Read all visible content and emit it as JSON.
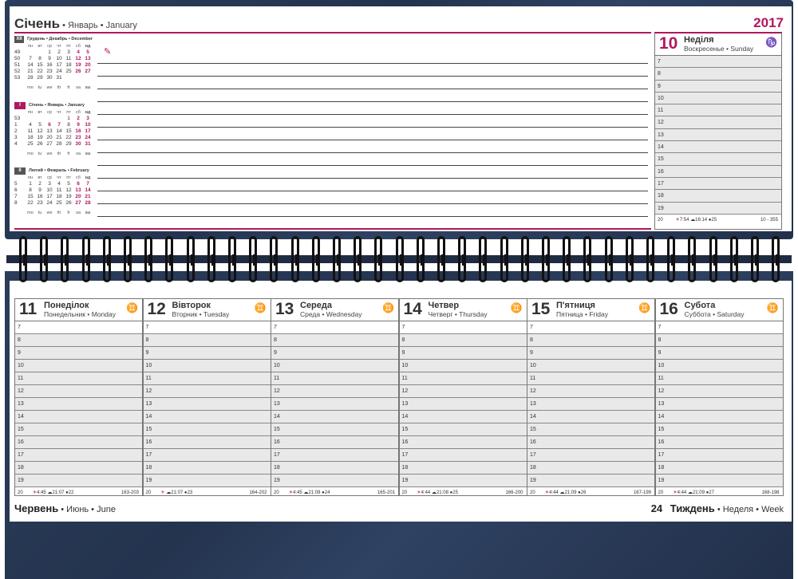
{
  "header": {
    "month_ua": "Січень",
    "month_sub": " • Январь • January",
    "year": "2017"
  },
  "mini_calendars": [
    {
      "num": "XII",
      "num_color": "#555555",
      "name": "Грудень • Декабрь • December",
      "dow": [
        "пн",
        "вт",
        "ср",
        "чт",
        "пт",
        "сб",
        "нд"
      ],
      "weeks": [
        {
          "wk": "49",
          "days": [
            "",
            "",
            "1",
            "2",
            "3",
            "4",
            "5"
          ]
        },
        {
          "wk": "50",
          "days": [
            "7",
            "8",
            "9",
            "10",
            "11",
            "12",
            "13"
          ]
        },
        {
          "wk": "51",
          "days": [
            "14",
            "15",
            "16",
            "17",
            "18",
            "19",
            "20"
          ]
        },
        {
          "wk": "52",
          "days": [
            "21",
            "22",
            "23",
            "24",
            "25",
            "26",
            "27"
          ]
        },
        {
          "wk": "53",
          "days": [
            "28",
            "29",
            "30",
            "31",
            "",
            "",
            ""
          ]
        }
      ],
      "en": [
        "mo",
        "tu",
        "we",
        "th",
        "fr",
        "sa",
        "su"
      ]
    },
    {
      "num": "I",
      "num_color": "#b0185e",
      "name": "Січень • Январь • January",
      "dow": [
        "пн",
        "вт",
        "ср",
        "чт",
        "пт",
        "сб",
        "нд"
      ],
      "weeks": [
        {
          "wk": "53",
          "days": [
            "",
            "",
            "",
            "",
            "1",
            "2",
            "3"
          ]
        },
        {
          "wk": "1",
          "days": [
            "4",
            "5",
            "6",
            "7",
            "8",
            "9",
            "10"
          ]
        },
        {
          "wk": "2",
          "days": [
            "11",
            "12",
            "13",
            "14",
            "15",
            "16",
            "17"
          ]
        },
        {
          "wk": "3",
          "days": [
            "18",
            "19",
            "20",
            "21",
            "22",
            "23",
            "24"
          ]
        },
        {
          "wk": "4",
          "days": [
            "25",
            "26",
            "27",
            "28",
            "29",
            "30",
            "31"
          ]
        }
      ],
      "en": [
        "mo",
        "tu",
        "we",
        "th",
        "fr",
        "sa",
        "su"
      ]
    },
    {
      "num": "II",
      "num_color": "#555555",
      "name": "Лютий • Февраль • February",
      "dow": [
        "пн",
        "вт",
        "ср",
        "чт",
        "пт",
        "сб",
        "нд"
      ],
      "weeks": [
        {
          "wk": "5",
          "days": [
            "1",
            "2",
            "3",
            "4",
            "5",
            "6",
            "7"
          ]
        },
        {
          "wk": "6",
          "days": [
            "8",
            "9",
            "10",
            "11",
            "12",
            "13",
            "14"
          ]
        },
        {
          "wk": "7",
          "days": [
            "15",
            "16",
            "17",
            "18",
            "19",
            "20",
            "21"
          ]
        },
        {
          "wk": "8",
          "days": [
            "22",
            "23",
            "24",
            "25",
            "26",
            "27",
            "28"
          ]
        }
      ],
      "en": [
        "mo",
        "tu",
        "we",
        "th",
        "fr",
        "sa",
        "su"
      ]
    }
  ],
  "sunday": {
    "num": "10",
    "name": "Неділя",
    "sub": "Воскресенье • Sunday",
    "sign": "♑",
    "hours": [
      "7",
      "8",
      "9",
      "10",
      "11",
      "12",
      "13",
      "14",
      "15",
      "16",
      "17",
      "18",
      "19"
    ],
    "foot_hour": "20",
    "sunrise": "7:54",
    "sunset": "16:14",
    "moon": "25",
    "count": "10 - 355"
  },
  "week_days": [
    {
      "num": "11",
      "name": "Понеділок",
      "sub": "Понедельник • Monday",
      "sign": "♊",
      "sunrise": "4:45",
      "sunset": "21:07",
      "moon": "22",
      "count": "163-203"
    },
    {
      "num": "12",
      "name": "Вівторок",
      "sub": "Вторник • Tuesday",
      "sign": "♊",
      "sunrise": "",
      "sunset": "21:07",
      "moon": "23",
      "count": "164-202"
    },
    {
      "num": "13",
      "name": "Середа",
      "sub": "Среда • Wednesday",
      "sign": "♊",
      "sunrise": "4:45",
      "sunset": "21:08",
      "moon": "24",
      "count": "165-201"
    },
    {
      "num": "14",
      "name": "Четвер",
      "sub": "Четверг • Thursday",
      "sign": "♊",
      "sunrise": "4:44",
      "sunset": "21:08",
      "moon": "25",
      "count": "166-200"
    },
    {
      "num": "15",
      "name": "П'ятниця",
      "sub": "Пятница • Friday",
      "sign": "♊",
      "sunrise": "4:44",
      "sunset": "21:09",
      "moon": "26",
      "count": "167-199"
    },
    {
      "num": "16",
      "name": "Субота",
      "sub": "Суббота • Saturday",
      "sign": "♊",
      "sunrise": "4:44",
      "sunset": "21:09",
      "moon": "27",
      "count": "168-198"
    }
  ],
  "week_hours": [
    "7",
    "8",
    "9",
    "10",
    "11",
    "12",
    "13",
    "14",
    "15",
    "16",
    "17",
    "18",
    "19"
  ],
  "week_foot_hour": "20",
  "footer": {
    "month_ua": "Червень",
    "month_sub": " • Июнь • June",
    "week_num": "24",
    "week_ua": "Тиждень",
    "week_sub": " • Неделя • Week"
  }
}
